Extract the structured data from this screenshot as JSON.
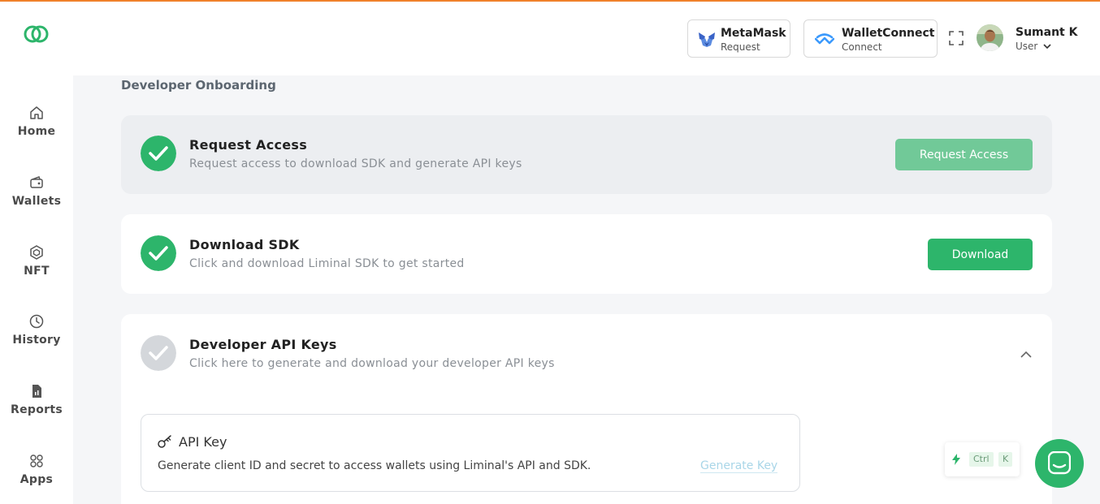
{
  "colors": {
    "accent_green": "#2db56b",
    "top_border_orange": "#f0812a",
    "check_pending": "#d4d7db"
  },
  "logo": {
    "icon": "rings-logo-icon"
  },
  "sidebar": {
    "items": [
      {
        "label": "Home",
        "icon": "home-icon"
      },
      {
        "label": "Wallets",
        "icon": "wallet-icon"
      },
      {
        "label": "NFT",
        "icon": "hexagon-icon"
      },
      {
        "label": "History",
        "icon": "clock-icon"
      },
      {
        "label": "Reports",
        "icon": "document-icon"
      },
      {
        "label": "Apps",
        "icon": "apps-grid-icon"
      }
    ]
  },
  "header": {
    "metamask": {
      "name": "MetaMask",
      "sub": "Request",
      "icon": "metamask-fox-icon"
    },
    "walletconnect": {
      "name": "WalletConnect",
      "sub": "Connect",
      "icon": "walletconnect-icon"
    },
    "expand_icon": "fullscreen-icon",
    "user": {
      "name": "Sumant K",
      "role": "User"
    }
  },
  "main": {
    "title": "Developer Onboarding",
    "steps": [
      {
        "title": "Request Access",
        "description": "Request access to download SDK and generate API keys",
        "button": "Request Access",
        "status": "complete"
      },
      {
        "title": "Download SDK",
        "description": "Click and download Liminal SDK to get started",
        "button": "Download",
        "status": "complete"
      },
      {
        "title": "Developer API Keys",
        "description": "Click here to generate and download your developer API keys",
        "status": "pending",
        "expanded": true
      }
    ],
    "api_key": {
      "title": "API Key",
      "description": "Generate client ID and secret to access wallets using Liminal's API and SDK.",
      "link": "Generate Key"
    }
  },
  "shortcut": {
    "ctrl": "Ctrl",
    "key": "K"
  }
}
